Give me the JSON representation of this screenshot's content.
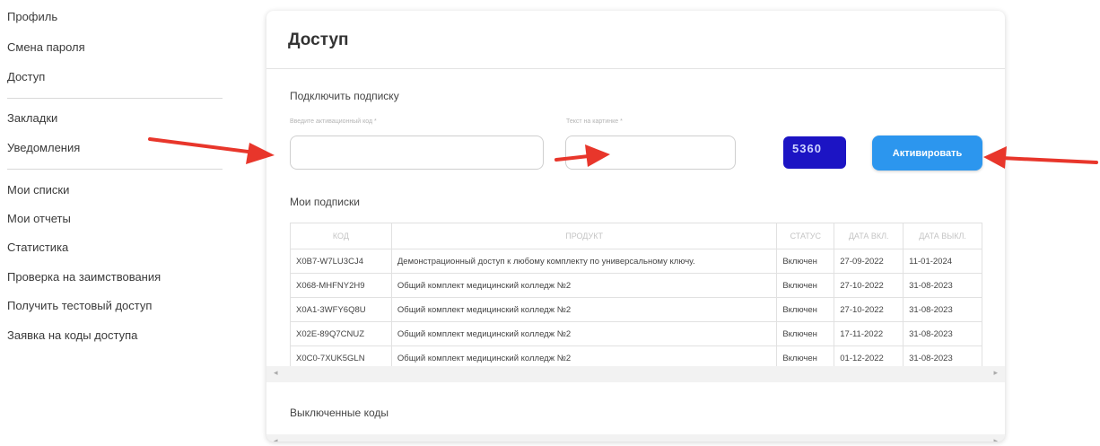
{
  "sidebar": {
    "items": [
      {
        "label": "Профиль"
      },
      {
        "label": "Смена пароля"
      },
      {
        "label": "Доступ"
      },
      {
        "label": "Закладки"
      },
      {
        "label": "Уведомления"
      },
      {
        "label": "Мои списки"
      },
      {
        "label": "Мои отчеты"
      },
      {
        "label": "Статистика"
      },
      {
        "label": "Проверка на заимствования"
      },
      {
        "label": "Получить тестовый доступ"
      },
      {
        "label": "Заявка на коды доступа"
      }
    ]
  },
  "main": {
    "title": "Доступ",
    "subscribe_section": "Подключить подписку",
    "code_field": {
      "label": "Введите активационный код *",
      "value": "",
      "placeholder": ""
    },
    "captcha_field": {
      "label": "Текст на картинке *",
      "value": "",
      "placeholder": ""
    },
    "captcha_text": "5360",
    "activate_button": "Активировать",
    "my_subscriptions": "Мои подписки",
    "disabled_codes": "Выключенные коды",
    "table": {
      "headers": [
        "КОД",
        "ПРОДУКТ",
        "СТАТУС",
        "ДАТА ВКЛ.",
        "ДАТА ВЫКЛ."
      ],
      "rows": [
        [
          "X0B7-W7LU3CJ4",
          "Демонстрационный доступ к любому комплекту по универсальному ключу.",
          "Включен",
          "27-09-2022",
          "11-01-2024"
        ],
        [
          "X068-MHFNY2H9",
          "Общий комплект медицинский колледж №2",
          "Включен",
          "27-10-2022",
          "31-08-2023"
        ],
        [
          "X0A1-3WFY6Q8U",
          "Общий комплект медицинский колледж №2",
          "Включен",
          "27-10-2022",
          "31-08-2023"
        ],
        [
          "X02E-89Q7CNUZ",
          "Общий комплект медицинский колледж №2",
          "Включен",
          "17-11-2022",
          "31-08-2023"
        ],
        [
          "X0C0-7XUK5GLN",
          "Общий комплект медицинский колледж №2",
          "Включен",
          "01-12-2022",
          "31-08-2023"
        ]
      ]
    }
  },
  "colors": {
    "accent": "#2c96ee",
    "captcha_bg": "#1c14c4",
    "annotation_arrow": "#e8362b"
  },
  "icons": {
    "scroll_left": "◂",
    "scroll_right": "▸"
  }
}
